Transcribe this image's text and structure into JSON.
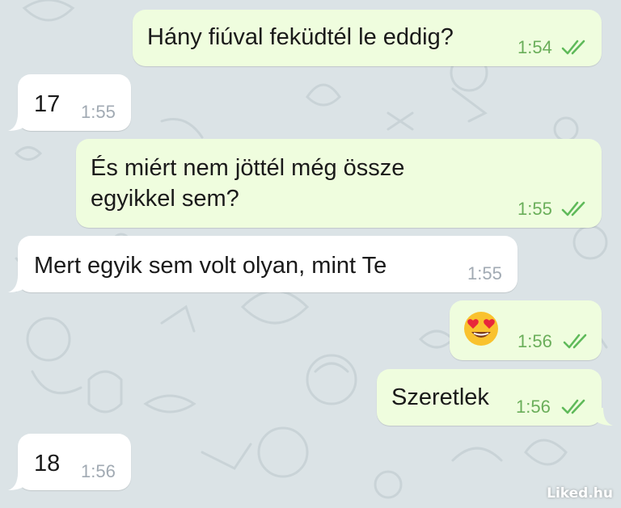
{
  "messages": [
    {
      "direction": "outgoing",
      "text": "Hány fiúval feküdtél le eddig?",
      "time": "1:54",
      "read": true
    },
    {
      "direction": "incoming",
      "text": "17",
      "time": "1:55"
    },
    {
      "direction": "outgoing",
      "text_line1": "És miért nem jöttél még össze",
      "text_line2": "egyikkel sem?",
      "time": "1:55",
      "read": true
    },
    {
      "direction": "incoming",
      "text": "Mert egyik sem volt olyan, mint Te",
      "time": "1:55"
    },
    {
      "direction": "outgoing",
      "emoji": "heart-eyes-emoji",
      "time": "1:56",
      "read": true
    },
    {
      "direction": "outgoing",
      "text": "Szeretlek",
      "time": "1:56",
      "read": true
    },
    {
      "direction": "incoming",
      "text": "18",
      "time": "1:56"
    }
  ],
  "watermark": "Liked.hu",
  "colors": {
    "background": "#dbe3e6",
    "outgoing_bubble": "#effdde",
    "incoming_bubble": "#ffffff",
    "outgoing_time": "#6aae5a",
    "incoming_time": "#a1aab3",
    "check_marks": "#5fba5a"
  }
}
